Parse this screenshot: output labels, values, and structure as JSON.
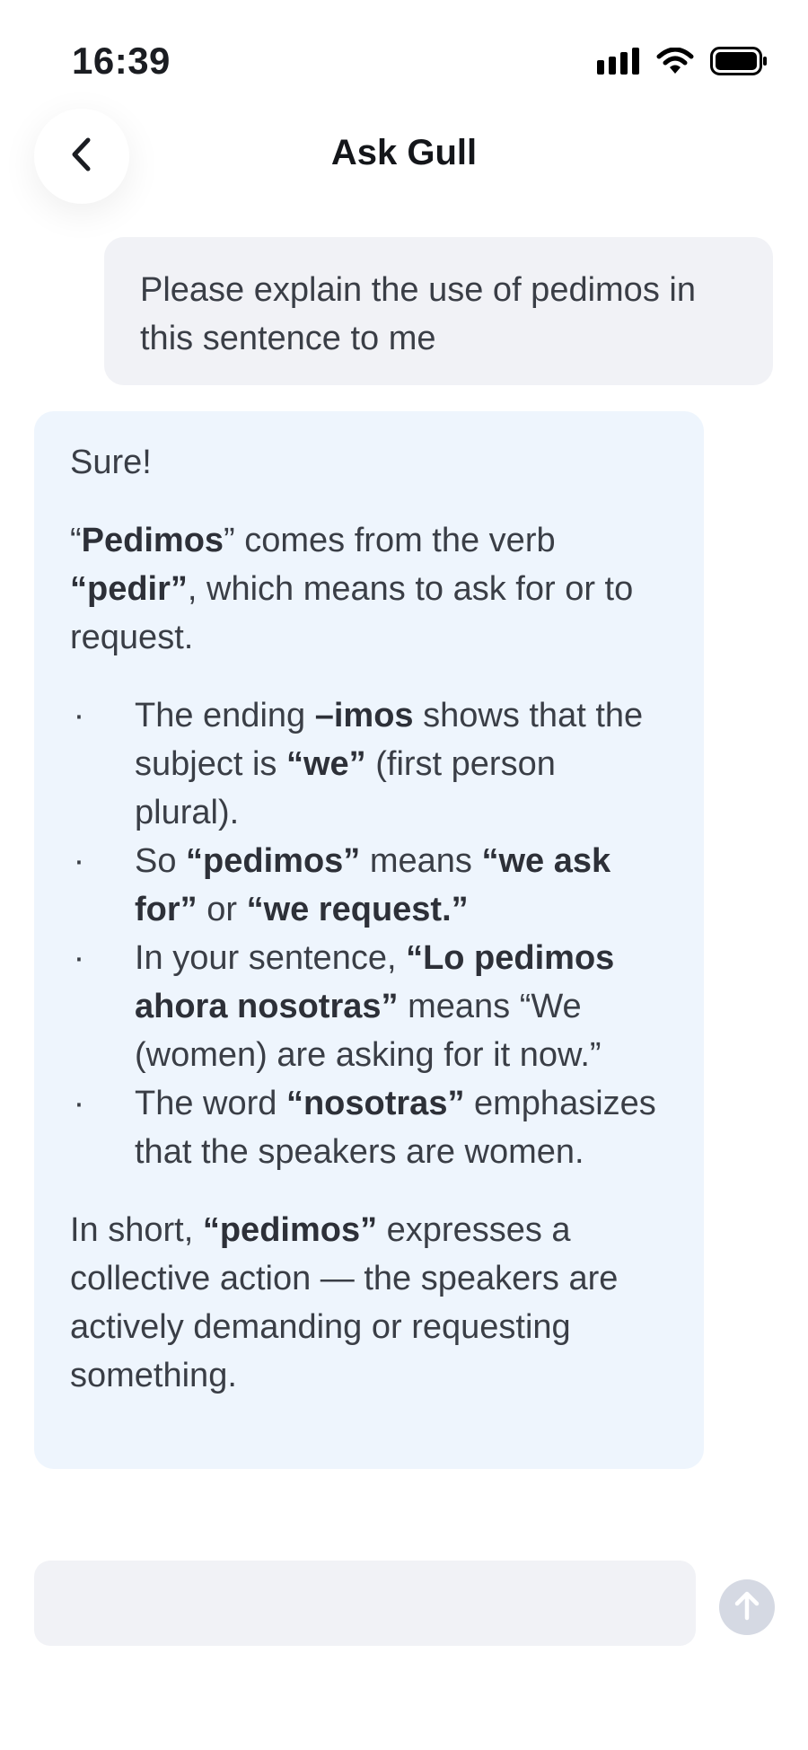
{
  "status_bar": {
    "time": "16:39"
  },
  "header": {
    "title": "Ask Gull"
  },
  "messages": {
    "user": {
      "text": "Please explain the use of pedimos in this sentence to me"
    },
    "assistant": {
      "greeting": "Sure!",
      "intro": {
        "q1": "“",
        "word": "Pedimos",
        "q2": "”",
        "t1": " comes from the verb ",
        "verb": "“pedir”",
        "t2": ", which means to ask for or to request."
      },
      "bullet_marker": "·",
      "bullets": [
        {
          "a": "The ending ",
          "b": "–imos",
          "c": " shows that the subject is ",
          "d": "“we”",
          "e": " (first person plural)."
        },
        {
          "a": "So ",
          "b": "“pedimos”",
          "c": " means ",
          "d": "“we ask for”",
          "e": " or ",
          "f": "“we request.”"
        },
        {
          "a": "In your sentence, ",
          "b": "“Lo pedimos ahora nosotras”",
          "c": " means “We (women) are asking for it now.”"
        },
        {
          "a": "The word ",
          "b": "“nosotras”",
          "c": " emphasizes that the speakers are women."
        }
      ],
      "summary": {
        "a": "In short, ",
        "b": "“pedimos”",
        "c": " expresses a collective action — the speakers are actively demanding or requesting something."
      }
    }
  },
  "composer": {
    "value": "",
    "placeholder": ""
  },
  "icons": {
    "back": "chevron-left-icon",
    "send": "arrow-up-icon",
    "signal": "cellular-signal-icon",
    "wifi": "wifi-icon",
    "battery": "battery-icon"
  },
  "colors": {
    "user_bubble": "#f1f2f6",
    "assistant_bubble": "#eef5fd",
    "send_button": "#d5d9e3"
  }
}
